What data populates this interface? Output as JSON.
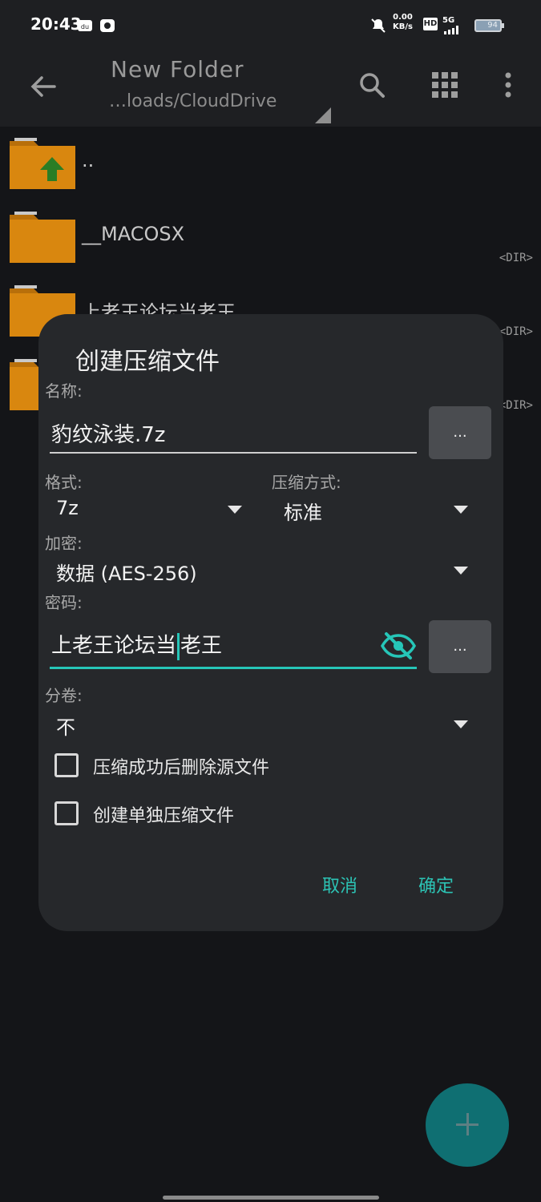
{
  "status": {
    "time": "20:43",
    "net_speed": "0.00",
    "net_unit": "KB/s",
    "hd": "HD",
    "signal": "5G",
    "battery": "94"
  },
  "appbar": {
    "title": "New Folder",
    "path": "…loads/CloudDrive"
  },
  "files": [
    {
      "name": "..",
      "tag": ""
    },
    {
      "name": "__MACOSX",
      "tag": "<DIR>"
    },
    {
      "name": "上老王论坛当老王",
      "tag": "<DIR>"
    },
    {
      "name": "",
      "tag": "<DIR>"
    }
  ],
  "dialog": {
    "title": "创建压缩文件",
    "name_label": "名称:",
    "name_value": "豹纹泳装.7z",
    "dots": "...",
    "format_label": "格式:",
    "format_value": "7z",
    "method_label": "压缩方式:",
    "method_value": "标准",
    "encrypt_label": "加密:",
    "encrypt_value": "数据 (AES-256)",
    "password_label": "密码:",
    "password_value_a": "上老王论坛当",
    "password_value_b": "老王",
    "split_label": "分卷:",
    "split_value": "不",
    "check1": "压缩成功后删除源文件",
    "check2": "创建单独压缩文件",
    "cancel": "取消",
    "ok": "确定"
  },
  "colors": {
    "accent": "#26c6b8",
    "folder": "#d9870f",
    "dialog_bg": "#26282b"
  }
}
